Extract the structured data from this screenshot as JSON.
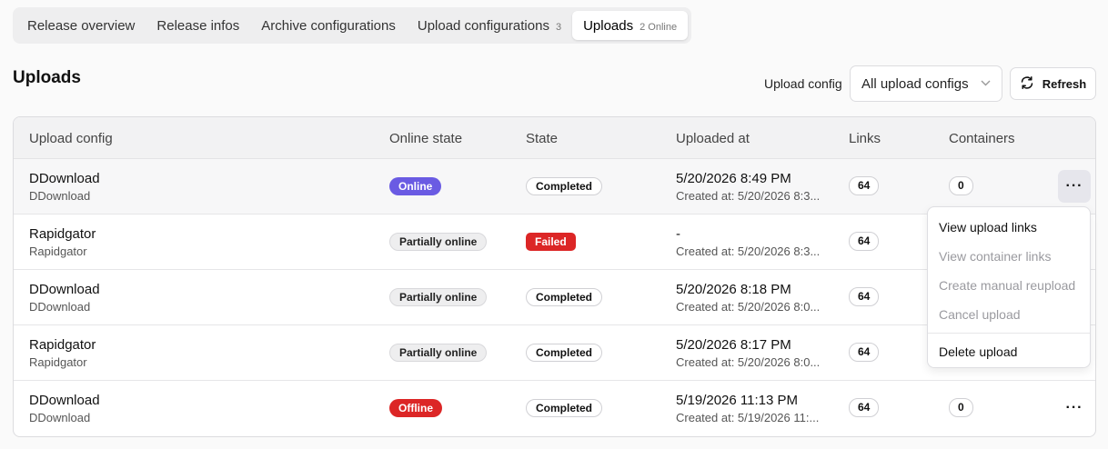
{
  "tabs": [
    {
      "label": "Release overview",
      "count": ""
    },
    {
      "label": "Release infos",
      "count": ""
    },
    {
      "label": "Archive configurations",
      "count": ""
    },
    {
      "label": "Upload configurations",
      "count": "3"
    },
    {
      "label": "Uploads",
      "count": "2 Online"
    }
  ],
  "page_title": "Uploads",
  "filter": {
    "label": "Upload config",
    "selected": "All upload configs"
  },
  "refresh_label": "Refresh",
  "columns": [
    "Upload config",
    "Online state",
    "State",
    "Uploaded at",
    "Links",
    "Containers"
  ],
  "rows": [
    {
      "name": "DDownload",
      "sub": "DDownload",
      "online": "Online",
      "state": "Completed",
      "uploaded": "5/20/2026 8:49 PM",
      "created": "Created at: 5/20/2026 8:3...",
      "links": "64",
      "containers": "0"
    },
    {
      "name": "Rapidgator",
      "sub": "Rapidgator",
      "online": "Partially online",
      "state": "Failed",
      "uploaded": "-",
      "created": "Created at: 5/20/2026 8:3...",
      "links": "64",
      "containers": ""
    },
    {
      "name": "DDownload",
      "sub": "DDownload",
      "online": "Partially online",
      "state": "Completed",
      "uploaded": "5/20/2026 8:18 PM",
      "created": "Created at: 5/20/2026 8:0...",
      "links": "64",
      "containers": ""
    },
    {
      "name": "Rapidgator",
      "sub": "Rapidgator",
      "online": "Partially online",
      "state": "Completed",
      "uploaded": "5/20/2026 8:17 PM",
      "created": "Created at: 5/20/2026 8:0...",
      "links": "64",
      "containers": ""
    },
    {
      "name": "DDownload",
      "sub": "DDownload",
      "online": "Offline",
      "state": "Completed",
      "uploaded": "5/19/2026 11:13 PM",
      "created": "Created at: 5/19/2026 11:...",
      "links": "64",
      "containers": "0"
    }
  ],
  "menu": {
    "view_links": "View upload links",
    "view_containers": "View container links",
    "manual_reupload": "Create manual reupload",
    "cancel": "Cancel upload",
    "delete": "Delete upload"
  },
  "more_glyph": "···",
  "colors": {
    "online": "#6a5be3",
    "danger": "#dc2626"
  }
}
